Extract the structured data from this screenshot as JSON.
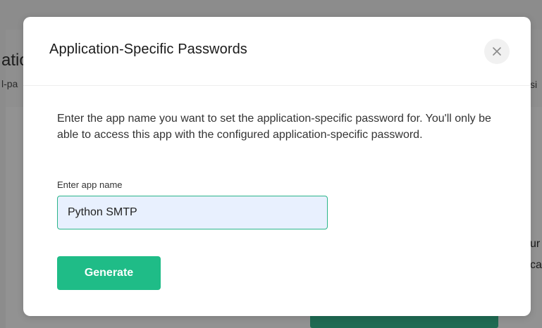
{
  "background": {
    "title_fragment": "atio",
    "subtitle_fragment": "l-pa",
    "right_fragment_1": "si",
    "right_fragment_2": "ur",
    "right_fragment_3": "ca"
  },
  "modal": {
    "title": "Application-Specific Passwords",
    "close_icon": "close-icon",
    "description": "Enter the app name you want to set the application-specific password for. You'll only be able to access this app with the configured application-specific password.",
    "field": {
      "label": "Enter app name",
      "value": "Python SMTP"
    },
    "generate_label": "Generate"
  },
  "colors": {
    "primary": "#1fbc87",
    "input_border": "#2bb58a",
    "input_bg": "#e8f0fe"
  }
}
